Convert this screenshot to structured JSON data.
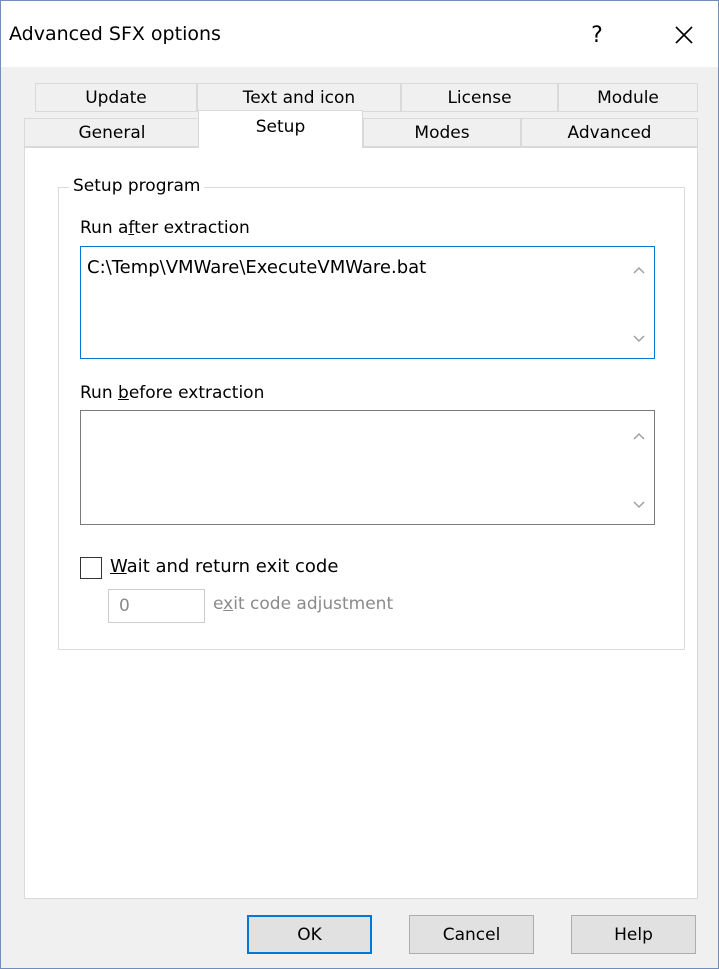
{
  "window": {
    "title": "Advanced SFX options",
    "help_glyph": "?",
    "close_icon": "close-icon"
  },
  "tabs": {
    "row1": [
      "Update",
      "Text and icon",
      "License",
      "Module"
    ],
    "row2": [
      "General",
      "Setup",
      "Modes",
      "Advanced"
    ],
    "active": "Setup"
  },
  "setup": {
    "group_title": "Setup program",
    "run_after_label_pre": "Run a",
    "run_after_label_u": "f",
    "run_after_label_post": "ter extraction",
    "run_after_value": "C:\\Temp\\VMWare\\ExecuteVMWare.bat",
    "run_before_label_pre": "Run ",
    "run_before_label_u": "b",
    "run_before_label_post": "efore extraction",
    "run_before_value": "",
    "wait_label_u": "W",
    "wait_label_post": "ait and return exit code",
    "wait_checked": false,
    "exit_code_value": "0",
    "exit_adj_pre": "e",
    "exit_adj_u": "x",
    "exit_adj_post": "it code adjustment"
  },
  "buttons": {
    "ok": "OK",
    "cancel": "Cancel",
    "help": "Help"
  },
  "colors": {
    "accent": "#0078d7",
    "disabled_text": "#8a8a8a"
  }
}
